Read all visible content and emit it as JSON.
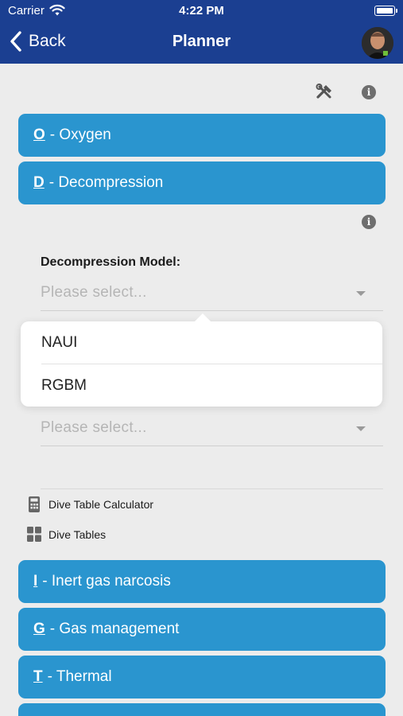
{
  "status_bar": {
    "carrier": "Carrier",
    "time": "4:22 PM"
  },
  "nav": {
    "back_label": "Back",
    "title": "Planner"
  },
  "sections_top": [
    {
      "letter": "O",
      "label": "- Oxygen"
    },
    {
      "letter": "D",
      "label": "- Decompression"
    }
  ],
  "decompression": {
    "model_label": "Decompression Model:",
    "model_placeholder": "Please select...",
    "second_placeholder": "Please select...",
    "options": [
      "NAUI",
      "RGBM"
    ]
  },
  "links": {
    "calculator": "Dive Table Calculator",
    "tables": "Dive Tables"
  },
  "sections_bottom": [
    {
      "letter": "I",
      "label": "- Inert gas narcosis"
    },
    {
      "letter": "G",
      "label": "- Gas management"
    },
    {
      "letter": "T",
      "label": "- Thermal"
    }
  ],
  "icons": {
    "info": "i"
  },
  "colors": {
    "header": "#1b3f91",
    "section": "#2a95cf",
    "background": "#ececec"
  }
}
